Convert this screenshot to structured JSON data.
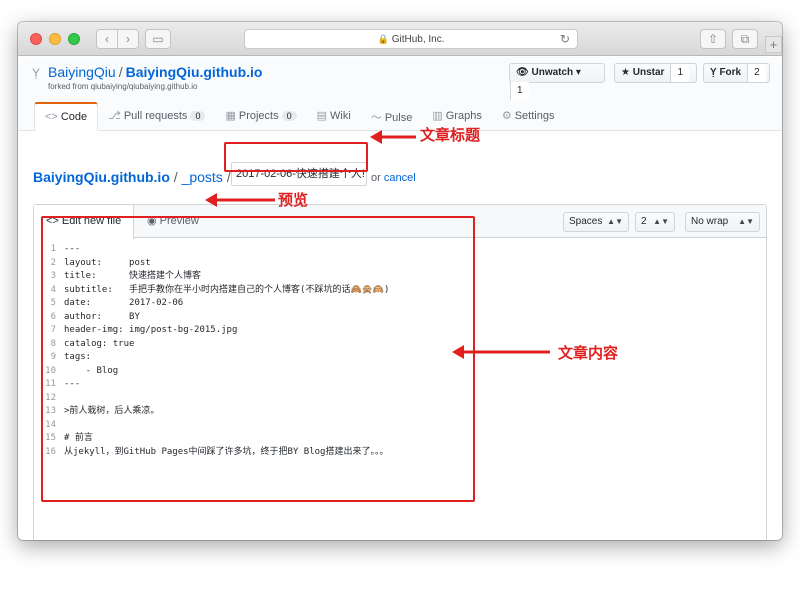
{
  "browser": {
    "address_text": "GitHub, Inc.",
    "plus_label": "+"
  },
  "repo": {
    "owner": "BaiyingQiu",
    "separator": "/",
    "name": "BaiyingQiu.github.io",
    "forked_from": "forked from qiubaiying/qiubaiying.github.io"
  },
  "actions": {
    "watch_label": "Unwatch ▾",
    "watch_count": "1",
    "star_label": "Unstar",
    "star_count": "1",
    "fork_label": "Fork",
    "fork_count": "2"
  },
  "tabs": [
    {
      "label": "Code",
      "icon": "<>"
    },
    {
      "label": "Pull requests",
      "count": "0"
    },
    {
      "label": "Projects",
      "count": "0"
    },
    {
      "label": "Wiki"
    },
    {
      "label": "Pulse"
    },
    {
      "label": "Graphs"
    },
    {
      "label": "Settings"
    }
  ],
  "breadcrumb": {
    "repo": "BaiyingQiu.github.io",
    "sep1": " / ",
    "dir": "_posts",
    "sep2": " /"
  },
  "filename_value": "2017-02-06-快速搭建个人!",
  "cancel": {
    "or": "or",
    "link": "cancel"
  },
  "editor": {
    "edit_tab": "Edit new file",
    "preview_tab": "Preview",
    "indent_mode": "Spaces",
    "indent_size": "2",
    "wrap_mode": "No wrap",
    "lines": [
      {
        "n": "1",
        "text": "---"
      },
      {
        "n": "2",
        "text": "layout:     post"
      },
      {
        "n": "3",
        "text": "title:      快速搭建个人博客"
      },
      {
        "n": "4",
        "text": "subtitle:   手把手教你在半小时内搭建自己的个人博客(不踩坑的话🙈🙊🙉)"
      },
      {
        "n": "5",
        "text": "date:       2017-02-06"
      },
      {
        "n": "6",
        "text": "author:     BY"
      },
      {
        "n": "7",
        "text": "header-img: img/post-bg-2015.jpg"
      },
      {
        "n": "8",
        "text": "catalog: true"
      },
      {
        "n": "9",
        "text": "tags:"
      },
      {
        "n": "10",
        "text": "    - Blog"
      },
      {
        "n": "11",
        "text": "---"
      },
      {
        "n": "12",
        "text": ""
      },
      {
        "n": "13",
        "text": ">前人栽树，后人乘凉。"
      },
      {
        "n": "14",
        "text": ""
      },
      {
        "n": "15",
        "text": "# 前言"
      },
      {
        "n": "16",
        "text": "从jekyll，到GitHub Pages中间踩了许多坑，终于把BY Blog搭建出来了。。。"
      }
    ]
  },
  "annotations": {
    "title_label": "文章标题",
    "preview_label": "预览",
    "content_label": "文章内容",
    "color": "#e02020"
  },
  "icons": {
    "back": "‹",
    "forward": "›",
    "sidebar": "▭",
    "share": "⇧",
    "tabs": "⧉",
    "lock": "🔒",
    "reload": "↻",
    "repo_fork": "Ỵ",
    "eye": "👁",
    "star": "★",
    "fork": "Ỵ",
    "pr": "⎇",
    "projects": "▦",
    "wiki": "▤",
    "pulse": "〜",
    "graphs": "▥",
    "gear": "⚙",
    "code": "<>",
    "preview_eye": "◉"
  }
}
